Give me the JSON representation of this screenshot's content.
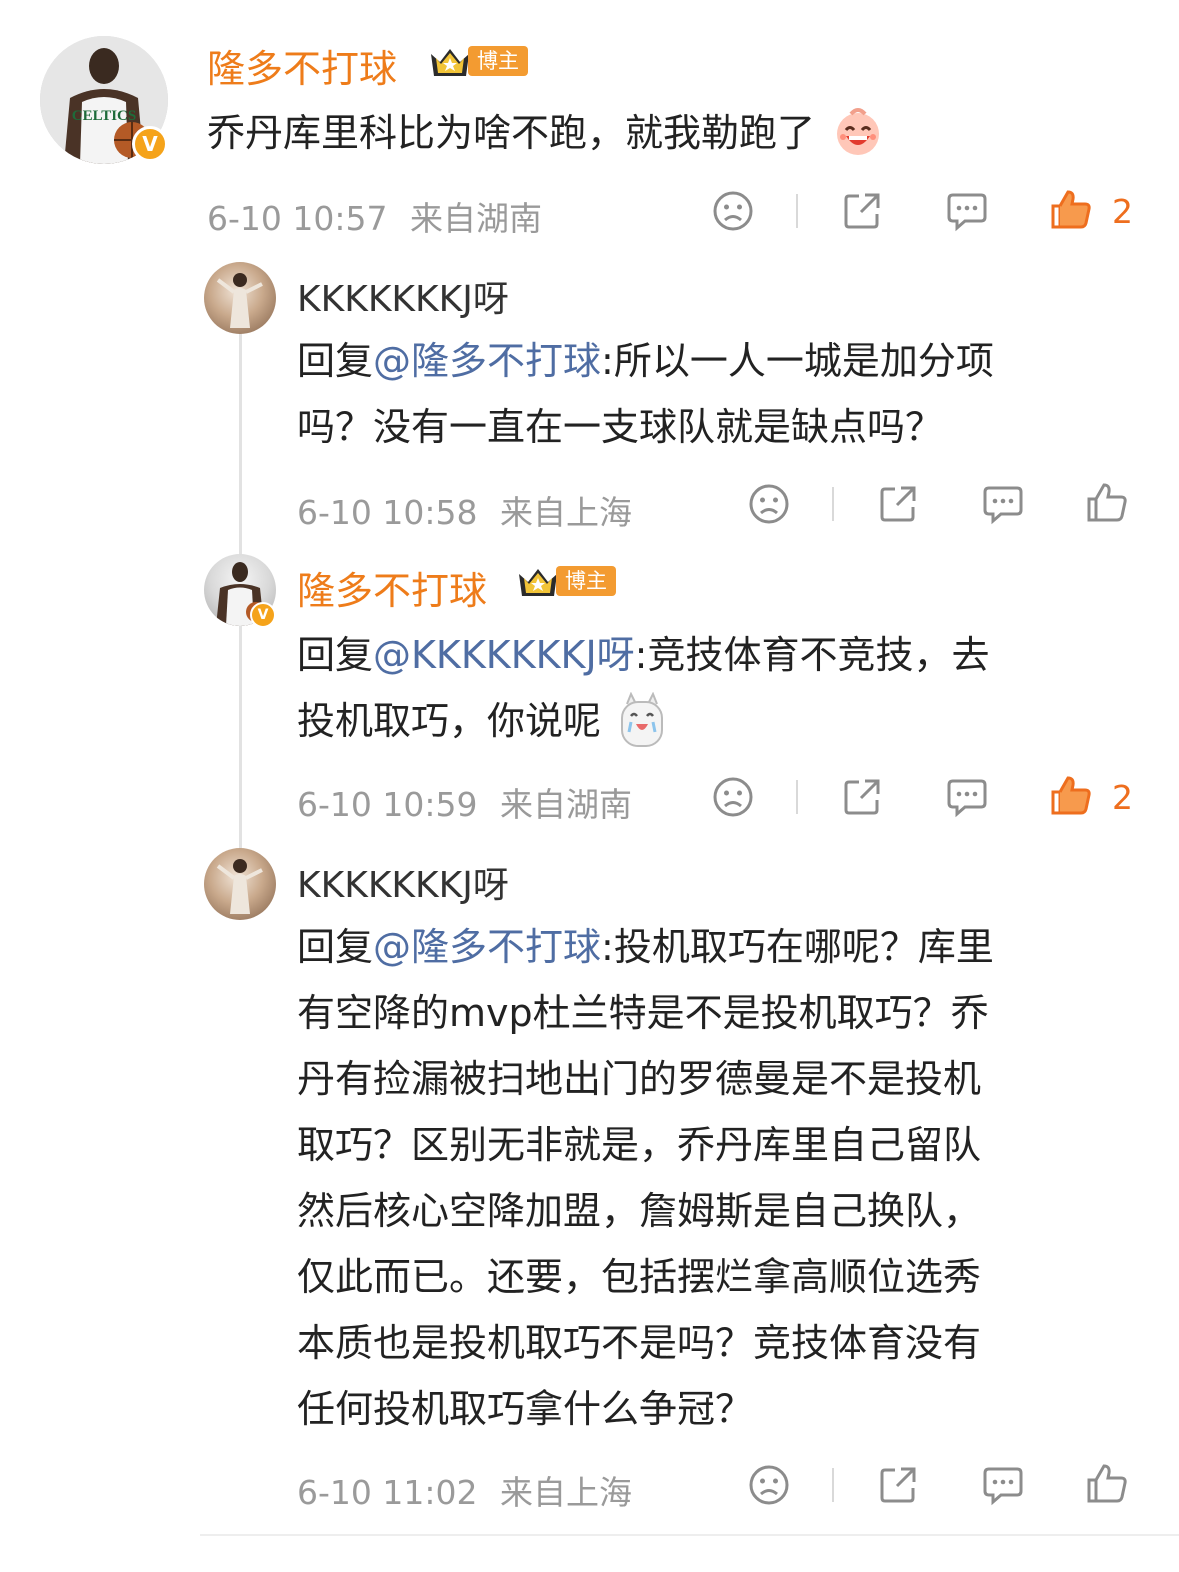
{
  "main_comment": {
    "username": "隆多不打球",
    "badge_label": "博主",
    "text": "乔丹库里科比为啥不跑，就我勒跑了",
    "time": "6-10 10:57",
    "location": "来自湖南",
    "like_count": "2"
  },
  "replies": [
    {
      "username": "KKKKKKKJ呀",
      "reply_prefix": "回复",
      "mention": "@隆多不打球",
      "line1": ":所以一人一城是加分项",
      "line2": "吗？没有一直在一支球队就是缺点吗？",
      "time": "6-10 10:58",
      "location": "来自上海"
    },
    {
      "username": "隆多不打球",
      "badge_label": "博主",
      "reply_prefix": "回复",
      "mention": "@KKKKKKKJ呀",
      "line1": ":竞技体育不竞技，去",
      "line2": "投机取巧，你说呢",
      "time": "6-10 10:59",
      "location": "来自湖南",
      "like_count": "2"
    },
    {
      "username": "KKKKKKKJ呀",
      "reply_prefix": "回复",
      "mention": "@隆多不打球",
      "line1": ":投机取巧在哪呢？库里",
      "lines": [
        "有空降的mvp杜兰特是不是投机取巧？乔",
        "丹有捡漏被扫地出门的罗德曼是不是投机",
        "取巧？区别无非就是，乔丹库里自己留队",
        "然后核心空降加盟，詹姆斯是自己换队，",
        "仅此而已。还要，包括摆烂拿高顺位选秀",
        "本质也是投机取巧不是吗？竞技体育没有",
        "任何投机取巧拿什么争冠？"
      ],
      "time": "6-10 11:02",
      "location": "来自上海"
    }
  ],
  "avatar_jersey_text": "CELTICS",
  "verified_mark": "V",
  "colors": {
    "username_orange": "#ee7c1a",
    "mention_blue": "#4f6da3",
    "meta_gray": "#9a9a9a",
    "like_orange": "#ee6e1e",
    "badge_orange": "#f39b31"
  },
  "icons": [
    "crown-badge-icon",
    "laugh-emoji-icon",
    "alpaca-emoji-icon",
    "sad-face-icon",
    "share-icon",
    "comment-icon",
    "thumbs-up-icon",
    "verified-v-icon"
  ]
}
